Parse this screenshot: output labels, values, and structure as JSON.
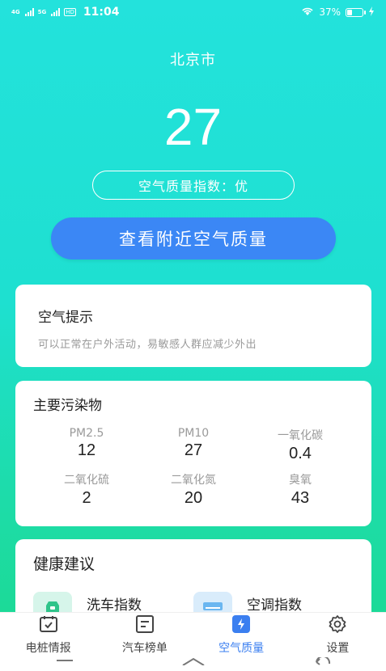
{
  "status_bar": {
    "net1": "4G",
    "net2": "5G",
    "hd": "HD",
    "time": "11:04",
    "battery": "37%",
    "battery_level": 0.37
  },
  "city": "北京市",
  "aqi": {
    "value": "27",
    "badge": "空气质量指数：优"
  },
  "nearby_button": "查看附近空气质量",
  "tip": {
    "title": "空气提示",
    "text": "可以正常在户外活动，易敏感人群应减少外出"
  },
  "pollutants": {
    "title": "主要污染物",
    "items": [
      {
        "name": "PM2.5",
        "value": "12"
      },
      {
        "name": "PM10",
        "value": "27"
      },
      {
        "name": "一氧化碳",
        "value": "0.4"
      },
      {
        "name": "二氧化硫",
        "value": "2"
      },
      {
        "name": "二氧化氮",
        "value": "20"
      },
      {
        "name": "臭氧",
        "value": "43"
      }
    ]
  },
  "health": {
    "title": "健康建议",
    "items": [
      {
        "label": "洗车指数",
        "icon": "car-wash-icon"
      },
      {
        "label": "空调指数",
        "icon": "air-conditioner-icon"
      }
    ]
  },
  "tabs": [
    {
      "label": "电桩情报",
      "icon": "charging-pile-icon",
      "active": false
    },
    {
      "label": "汽车榜单",
      "icon": "car-ranking-icon",
      "active": false
    },
    {
      "label": "空气质量",
      "icon": "air-quality-icon",
      "active": true
    },
    {
      "label": "设置",
      "icon": "gear-icon",
      "active": false
    }
  ],
  "colors": {
    "accent": "#3b87f5",
    "active_tab": "#3b7ff0",
    "background_top": "#23e2dc",
    "background_bottom": "#1cd98f"
  }
}
